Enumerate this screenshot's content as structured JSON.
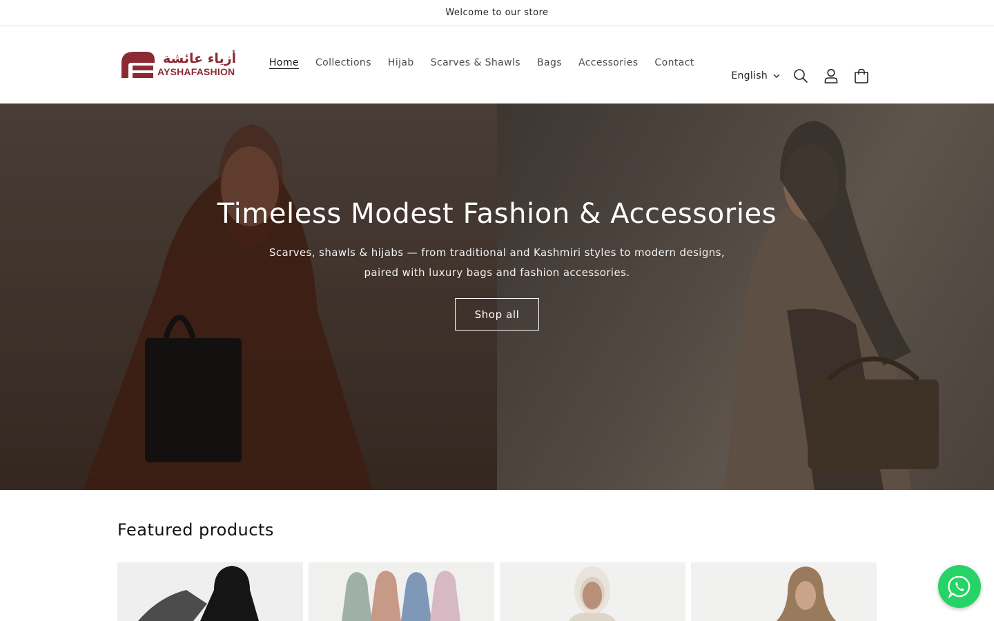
{
  "announcement": {
    "text": "Welcome to our store"
  },
  "logo": {
    "arabic": "أزياء عائشة",
    "latin": "AYSHAFASHION",
    "brand_color": "#8b2a33"
  },
  "nav": {
    "items": [
      {
        "label": "Home",
        "active": true
      },
      {
        "label": "Collections"
      },
      {
        "label": "Hijab"
      },
      {
        "label": "Scarves & Shawls"
      },
      {
        "label": "Bags"
      },
      {
        "label": "Accessories"
      },
      {
        "label": "Contact"
      }
    ]
  },
  "header_actions": {
    "language": "English",
    "icons": [
      "search-icon",
      "account-icon",
      "cart-icon"
    ]
  },
  "hero": {
    "title": "Timeless Modest Fashion & Accessories",
    "subtitle": "Scarves, shawls & hijabs — from traditional and Kashmiri styles to modern designs, paired with luxury bags and fashion accessories.",
    "button_label": "Shop all"
  },
  "featured": {
    "heading": "Featured products"
  },
  "whatsapp": {
    "icon": "whatsapp-icon",
    "color": "#25d366"
  }
}
